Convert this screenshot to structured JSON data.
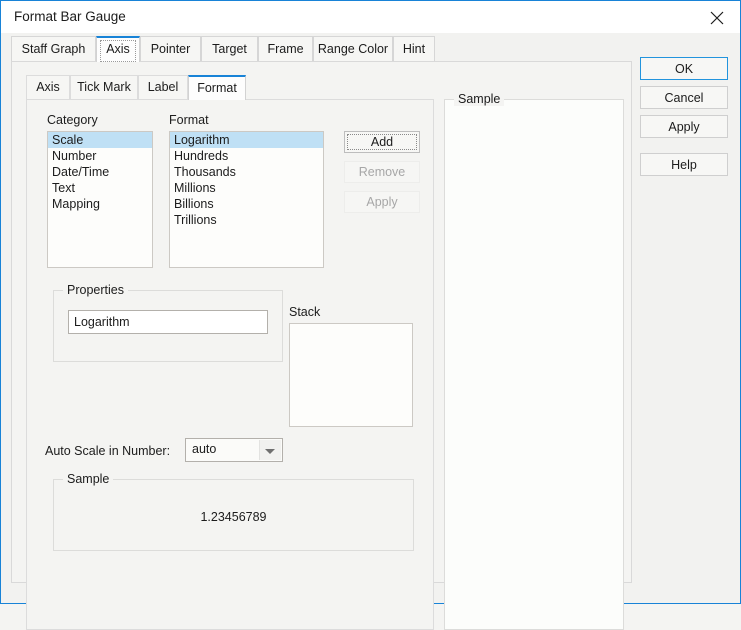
{
  "window": {
    "title": "Format Bar Gauge",
    "close_icon": "close-icon",
    "accent_color": "#1883d7",
    "face_color": "#f4f4f2"
  },
  "outer_tabs": [
    {
      "label": "Staff Graph",
      "selected": false
    },
    {
      "label": "Axis",
      "selected": true
    },
    {
      "label": "Pointer",
      "selected": false
    },
    {
      "label": "Target",
      "selected": false
    },
    {
      "label": "Frame",
      "selected": false
    },
    {
      "label": "Range Color",
      "selected": false
    },
    {
      "label": "Hint",
      "selected": false
    }
  ],
  "inner_tabs": [
    {
      "label": "Axis",
      "selected": false
    },
    {
      "label": "Tick Mark",
      "selected": false
    },
    {
      "label": "Label",
      "selected": false
    },
    {
      "label": "Format",
      "selected": true
    }
  ],
  "category": {
    "label": "Category",
    "items": [
      "Scale",
      "Number",
      "Date/Time",
      "Text",
      "Mapping"
    ],
    "selected_index": 0
  },
  "format": {
    "label": "Format",
    "items": [
      "Logarithm",
      "Hundreds",
      "Thousands",
      "Millions",
      "Billions",
      "Trillions"
    ],
    "selected_index": 0
  },
  "list_buttons": [
    {
      "label": "Add",
      "enabled": true,
      "focused": true
    },
    {
      "label": "Remove",
      "enabled": false,
      "focused": false
    },
    {
      "label": "Apply",
      "enabled": false,
      "focused": false
    }
  ],
  "properties": {
    "label": "Properties",
    "value": "Logarithm"
  },
  "stack": {
    "label": "Stack",
    "items": []
  },
  "auto_scale": {
    "label": "Auto Scale in Number:",
    "value": "auto",
    "options": [
      "auto"
    ]
  },
  "sample_left": {
    "label": "Sample",
    "value": "1.23456789"
  },
  "sample_right": {
    "label": "Sample",
    "value": ""
  },
  "dialog_buttons": [
    {
      "label": "OK",
      "default": true
    },
    {
      "label": "Cancel",
      "default": false
    },
    {
      "label": "Apply",
      "default": false
    },
    {
      "label": "Help",
      "default": false
    }
  ]
}
